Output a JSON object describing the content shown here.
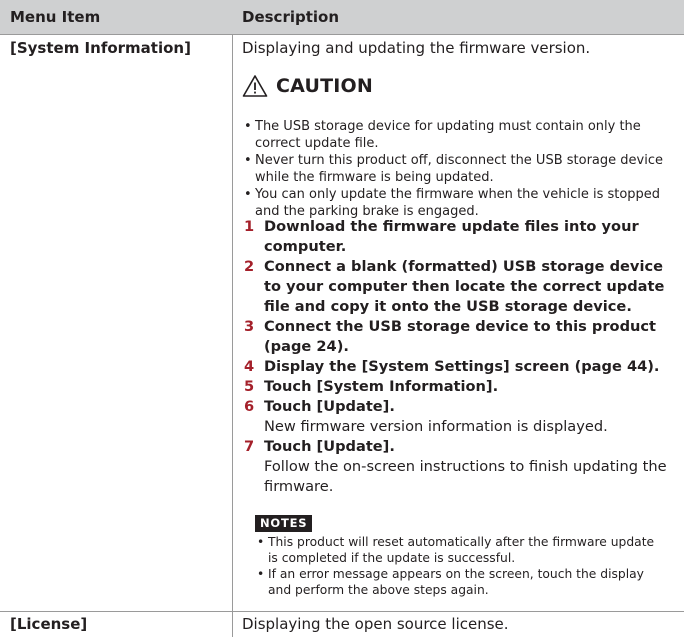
{
  "table": {
    "header": {
      "col1": "Menu Item",
      "col2": "Description"
    },
    "rows": [
      {
        "item": "[System Information]",
        "description": "Displaying and updating the firmware version.",
        "caution": {
          "title": "CAUTION",
          "icon": "warning-triangle-icon",
          "bullets": [
            "The USB storage device for updating must contain only the correct update file.",
            "Never turn this product off, disconnect the USB storage device while the firmware is being updated.",
            "You can only update the firmware when the vehicle is stopped and the parking brake is engaged."
          ]
        },
        "steps": [
          {
            "num": "1",
            "text": "Download the firmware update files into your computer.",
            "detail": ""
          },
          {
            "num": "2",
            "text": "Connect a blank (formatted) USB storage device to your computer then locate the correct update file and copy it onto the USB storage device.",
            "detail": ""
          },
          {
            "num": "3",
            "text": "Connect the USB storage device to this product (page 24).",
            "detail": ""
          },
          {
            "num": "4",
            "text": "Display the [System Settings] screen (page 44).",
            "detail": ""
          },
          {
            "num": "5",
            "text": "Touch [System Information].",
            "detail": ""
          },
          {
            "num": "6",
            "text": "Touch [Update].",
            "detail": "New firmware version information is displayed."
          },
          {
            "num": "7",
            "text": "Touch [Update].",
            "detail": "Follow the on-screen instructions to finish updating the firmware."
          }
        ],
        "notes": {
          "label": "NOTES",
          "bullets": [
            "This product will reset automatically after the firmware update is completed if the update is successful.",
            "If an error message appears on the screen, touch the display and perform the above steps again."
          ]
        }
      },
      {
        "item": "[License]",
        "description": "Displaying the open source license."
      }
    ]
  },
  "colors": {
    "header_bg": "#cfd0d1",
    "step_number": "#a4202a",
    "rule": "#9a9a9a"
  }
}
